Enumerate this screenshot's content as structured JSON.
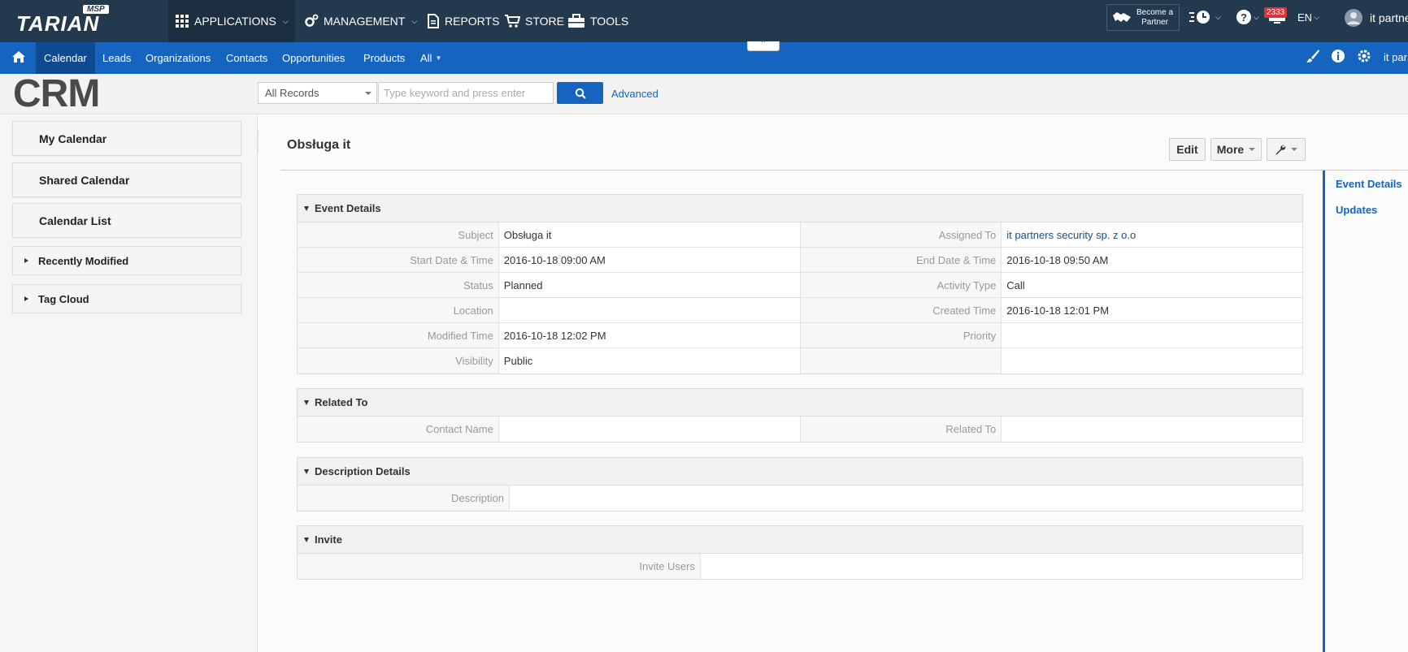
{
  "topbar": {
    "brand": "TARIAN",
    "brand_badge": "MSP",
    "nav": [
      {
        "label": "APPLICATIONS",
        "icon": "grid-icon"
      },
      {
        "label": "MANAGEMENT",
        "icon": "gears-icon"
      },
      {
        "label": "REPORTS",
        "icon": "document-icon"
      },
      {
        "label": "STORE",
        "icon": "cart-icon"
      },
      {
        "label": "TOOLS",
        "icon": "toolbox-icon"
      }
    ],
    "partner_label_1": "Become a",
    "partner_label_2": "Partner",
    "notification_count": "2333",
    "language": "EN",
    "user_name": "it partne"
  },
  "bluebar": {
    "tabs": [
      "Calendar",
      "Leads",
      "Organizations",
      "Contacts",
      "Opportunities",
      "Products",
      "All"
    ],
    "active_tab": "Calendar",
    "user_short": "it par"
  },
  "search": {
    "logo": "CRM",
    "scope": "All Records",
    "placeholder": "Type keyword and press enter",
    "advanced_label": "Advanced"
  },
  "sidebar": {
    "buttons": [
      "My Calendar",
      "Shared Calendar",
      "Calendar List"
    ],
    "boxes": [
      "Recently Modified",
      "Tag Cloud"
    ]
  },
  "record": {
    "title": "Obsługa it",
    "actions": {
      "edit": "Edit",
      "more": "More"
    }
  },
  "blocks": {
    "event": {
      "heading": "Event Details",
      "rows": [
        {
          "l1": "Subject",
          "v1": "Obsługa it",
          "l2": "Assigned To",
          "v2": "it partners security sp. z o.o"
        },
        {
          "l1": "Start Date & Time",
          "v1": "2016-10-18 09:00 AM",
          "l2": "End Date & Time",
          "v2": "2016-10-18 09:50 AM"
        },
        {
          "l1": "Status",
          "v1": "Planned",
          "l2": "Activity Type",
          "v2": "Call"
        },
        {
          "l1": "Location",
          "v1": "",
          "l2": "Created Time",
          "v2": "2016-10-18 12:01 PM"
        },
        {
          "l1": "Modified Time",
          "v1": "2016-10-18 12:02 PM",
          "l2": "Priority",
          "v2": ""
        },
        {
          "l1": "Visibility",
          "v1": "Public",
          "l2": "",
          "v2": ""
        }
      ]
    },
    "related": {
      "heading": "Related To",
      "l1": "Contact Name",
      "v1": "",
      "l2": "Related To",
      "v2": ""
    },
    "description": {
      "heading": "Description Details",
      "label": "Description",
      "value": ""
    },
    "invite": {
      "heading": "Invite",
      "label": "Invite Users",
      "value": ""
    }
  },
  "right_nav": [
    "Event Details",
    "Updates"
  ],
  "colors": {
    "topbar": "#23394e",
    "accent": "#1565c0"
  }
}
